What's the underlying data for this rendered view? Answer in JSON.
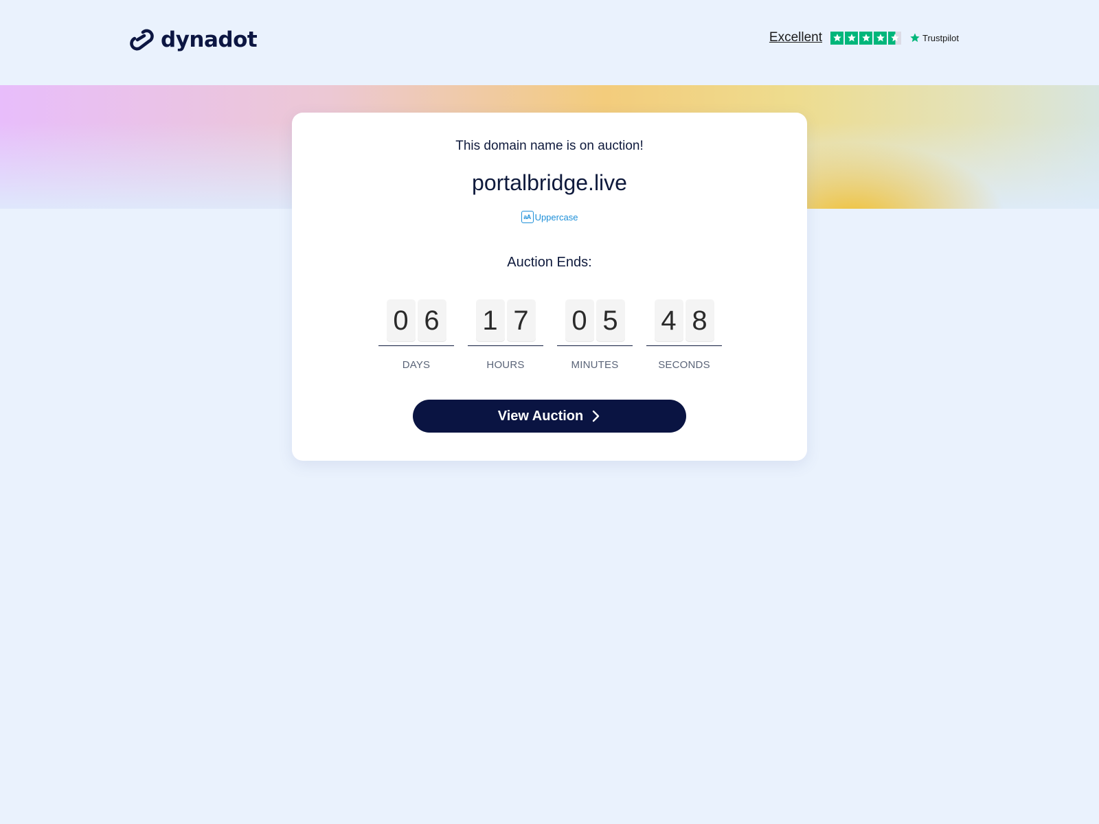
{
  "header": {
    "logo_text": "dynadot",
    "trustpilot": {
      "rating_label": "Excellent",
      "stars": 4.5,
      "brand": "Trustpilot",
      "star_color": "#00b67a"
    }
  },
  "card": {
    "subtitle": "This domain name is on auction!",
    "domain": "portalbridge.live",
    "uppercase_icon": "aA",
    "uppercase_label": "Uppercase",
    "ends_label": "Auction Ends:",
    "countdown": [
      {
        "label": "DAYS",
        "d1": "0",
        "d2": "6"
      },
      {
        "label": "HOURS",
        "d1": "1",
        "d2": "7"
      },
      {
        "label": "MINUTES",
        "d1": "0",
        "d2": "5"
      },
      {
        "label": "SECONDS",
        "d1": "4",
        "d2": "8"
      }
    ],
    "cta_label": "View Auction"
  },
  "colors": {
    "page_background": "#eaf2fd",
    "brand_navy": "#0a1442",
    "link_blue": "#1d8fd8"
  },
  "icons": [
    "dynadot-logo-icon",
    "star-icon",
    "trustpilot-star-icon",
    "case-toggle-icon",
    "chevron-right-icon"
  ]
}
